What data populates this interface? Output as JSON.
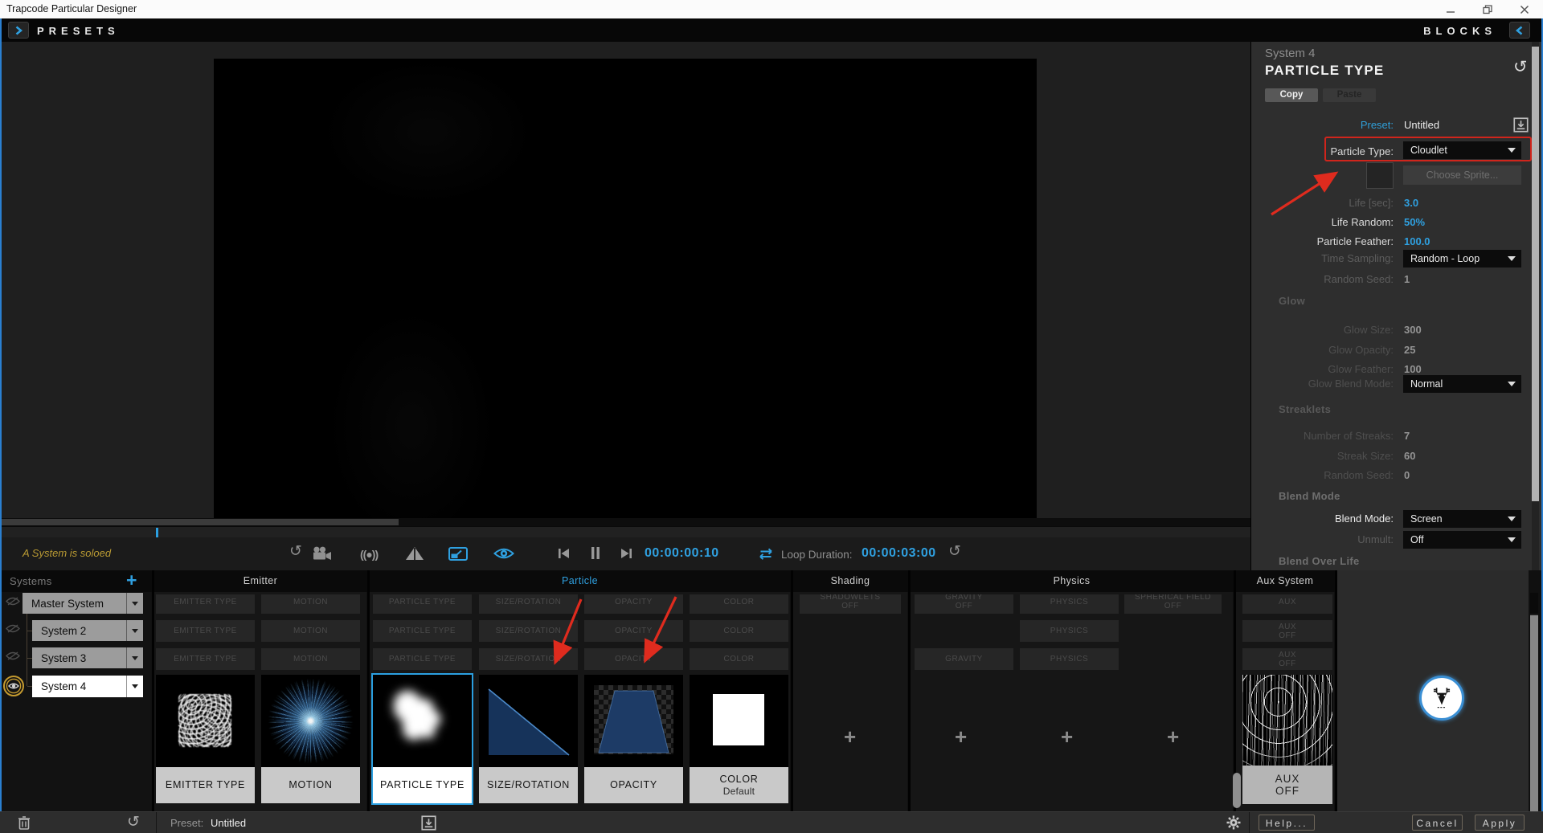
{
  "window": {
    "title": "Trapcode Particular Designer"
  },
  "topbar": {
    "presets": "PRESETS",
    "blocks": "BLOCKS"
  },
  "toolbar": {
    "solo_notice": "A System is soloed",
    "timecode": "00:00:00:10",
    "loop_label": "Loop Duration:",
    "loop_value": "00:00:03:00"
  },
  "icons": {
    "reset": "↺",
    "motion_blur": "((●))",
    "add": "+"
  },
  "inspector": {
    "system": "System 4",
    "title": "PARTICLE TYPE",
    "copy": "Copy",
    "paste": "Paste",
    "preset_label": "Preset:",
    "preset_value": "Untitled",
    "particle_type_label": "Particle Type:",
    "particle_type_value": "Cloudlet",
    "choose_sprite": "Choose Sprite...",
    "life_label": "Life [sec]:",
    "life_value": "3.0",
    "life_random_label": "Life Random:",
    "life_random_value": "50%",
    "feather_label": "Particle Feather:",
    "feather_value": "100.0",
    "time_sampling_label": "Time Sampling:",
    "time_sampling_value": "Random - Loop",
    "random_seed_label": "Random Seed:",
    "random_seed_value": "1",
    "glow_header": "Glow",
    "glow_size_label": "Glow Size:",
    "glow_size_value": "300",
    "glow_opacity_label": "Glow Opacity:",
    "glow_opacity_value": "25",
    "glow_feather_label": "Glow Feather:",
    "glow_feather_value": "100",
    "glow_blend_label": "Glow Blend Mode:",
    "glow_blend_value": "Normal",
    "streaklets_header": "Streaklets",
    "num_streaks_label": "Number of Streaks:",
    "num_streaks_value": "7",
    "streak_size_label": "Streak Size:",
    "streak_size_value": "60",
    "streak_seed_label": "Random Seed:",
    "streak_seed_value": "0",
    "blend_header": "Blend Mode",
    "blend_mode_label": "Blend Mode:",
    "blend_mode_value": "Screen",
    "unmult_label": "Unmult:",
    "unmult_value": "Off",
    "blend_over_life_header": "Blend Over Life"
  },
  "systems": {
    "header": "Systems",
    "items": [
      "Master System",
      "System 2",
      "System 3",
      "System 4"
    ]
  },
  "grid": {
    "headers": {
      "emitter": "Emitter",
      "particle": "Particle",
      "shading": "Shading",
      "physics": "Physics",
      "aux": "Aux System"
    },
    "blocks": {
      "emitter": [
        "EMITTER TYPE",
        "MOTION"
      ],
      "particle": [
        "PARTICLE TYPE",
        "SIZE/ROTATION",
        "OPACITY",
        "COLOR"
      ],
      "shading_row1": "SHADOWLETS\nOFF",
      "physics_row1": [
        "GRAVITY\nOFF",
        "PHYSICS",
        "SPHERICAL FIELD\nOFF"
      ],
      "physics_row2": "PHYSICS",
      "physics_row3": [
        "GRAVITY",
        "PHYSICS"
      ],
      "aux": [
        "AUX",
        "AUX\nOFF",
        "AUX\nOFF"
      ]
    },
    "cards": {
      "emitter_type": "EMITTER TYPE",
      "motion": "MOTION",
      "particle_type": "PARTICLE TYPE",
      "size_rotation": "SIZE/ROTATION",
      "opacity": "OPACITY",
      "color": "COLOR",
      "color_sub": "Default",
      "aux_line1": "AUX",
      "aux_line2": "OFF"
    }
  },
  "bottombar": {
    "preset_label": "Preset:",
    "preset_value": "Untitled",
    "help": "Help...",
    "cancel": "Cancel",
    "apply": "Apply"
  },
  "colors": {
    "accent": "#2fa0e0",
    "annotation": "#dd2a1c",
    "solo_text": "#b99a33",
    "solo_ring": "#c49a2f"
  }
}
